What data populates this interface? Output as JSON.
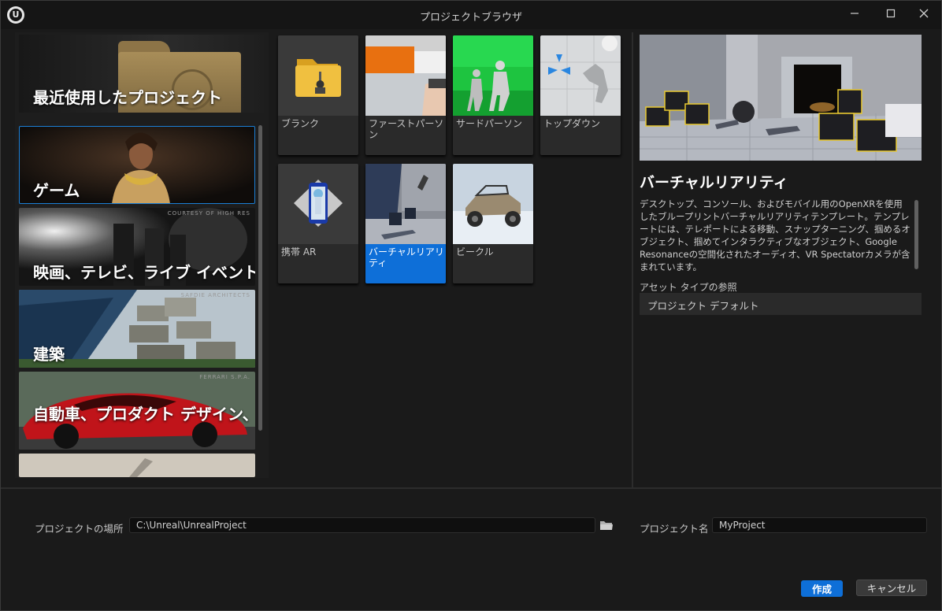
{
  "window": {
    "title": "プロジェクトブラウザ"
  },
  "categories": {
    "recent": "最近使用したプロジェクト",
    "items": [
      {
        "label": "ゲーム",
        "credit": "",
        "selected": true
      },
      {
        "label": "映画、テレビ、ライブ イベント",
        "credit": "COURTESY OF HIGH RES",
        "selected": false
      },
      {
        "label": "建築",
        "credit": "SAFDIE ARCHITECTS",
        "selected": false
      },
      {
        "label": "自動車、プロダクト デザイン、製造",
        "credit": "FERRARI S.P.A.",
        "selected": false
      }
    ]
  },
  "templates": [
    {
      "label": "ブランク",
      "selected": false
    },
    {
      "label": "ファーストパーソン",
      "selected": false
    },
    {
      "label": "サードパーソン",
      "selected": false
    },
    {
      "label": "トップダウン",
      "selected": false
    },
    {
      "label": "携帯 AR",
      "selected": false
    },
    {
      "label": "バーチャルリアリティ",
      "selected": true
    },
    {
      "label": "ビークル",
      "selected": false
    }
  ],
  "detail": {
    "title": "バーチャルリアリティ",
    "description": "デスクトップ、コンソール、およびモバイル用のOpenXRを使用したブループリントバーチャルリアリティテンプレート。テンプレートには、テレポートによる移動、スナップターニング、掴めるオブジェクト、掴めてインタラクティブなオブジェクト、Google Resonanceの空間化されたオーディオ、VR Spectatorカメラが含まれています。",
    "asset_type_label": "アセット タイプの参照",
    "asset_type_value": "プロジェクト デフォルト"
  },
  "bottom": {
    "location_label": "プロジェクトの場所",
    "location_value": "C:\\Unreal\\UnrealProject",
    "name_label": "プロジェクト名",
    "name_value": "MyProject",
    "create_label": "作成",
    "cancel_label": "キャンセル"
  },
  "colors": {
    "accent": "#0e6fd8",
    "background": "#1a1a1a",
    "panel": "#2a2a2a"
  }
}
